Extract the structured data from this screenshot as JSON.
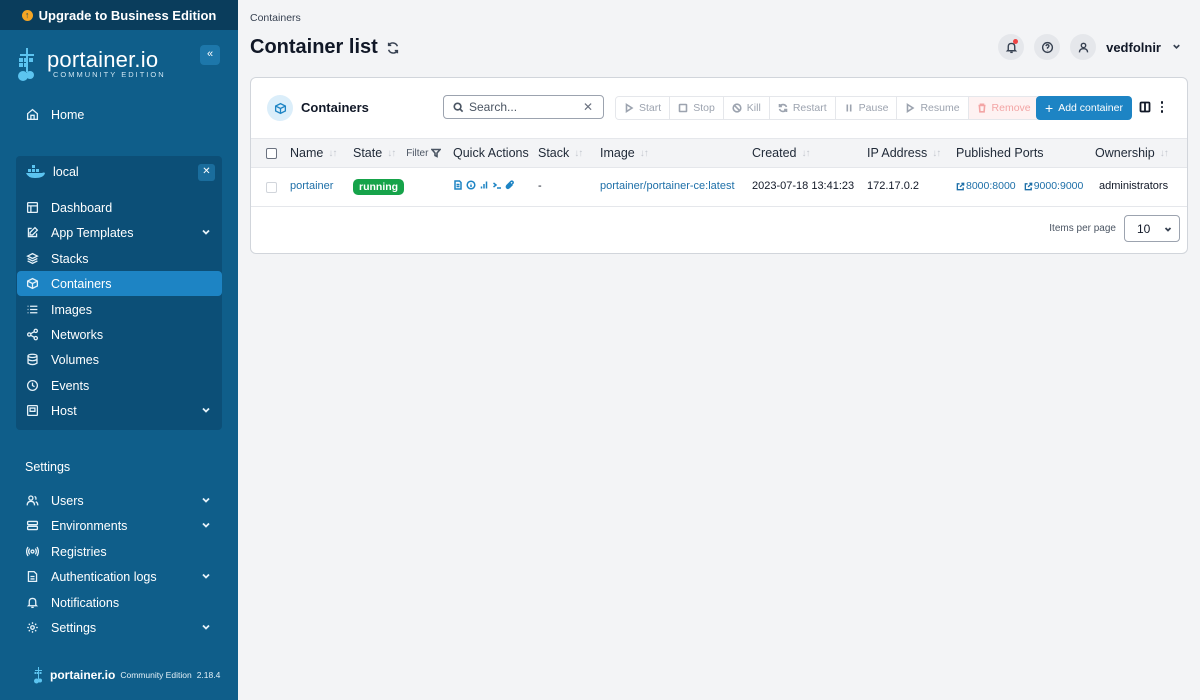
{
  "upgrade_banner": {
    "label": "Upgrade to Business Edition"
  },
  "brand": {
    "name": "portainer.io",
    "edition": "COMMUNITY EDITION"
  },
  "nav": {
    "home": "Home",
    "environment": {
      "name": "local"
    },
    "env_items": [
      {
        "label": "Dashboard",
        "icon": "dashboard-icon"
      },
      {
        "label": "App Templates",
        "icon": "edit-icon",
        "expandable": true
      },
      {
        "label": "Stacks",
        "icon": "layers-icon"
      },
      {
        "label": "Containers",
        "icon": "box-icon",
        "active": true
      },
      {
        "label": "Images",
        "icon": "list-icon"
      },
      {
        "label": "Networks",
        "icon": "share-icon"
      },
      {
        "label": "Volumes",
        "icon": "database-icon"
      },
      {
        "label": "Events",
        "icon": "clock-icon"
      },
      {
        "label": "Host",
        "icon": "host-icon",
        "expandable": true
      }
    ],
    "settings_title": "Settings",
    "settings_items": [
      {
        "label": "Users",
        "icon": "users-icon",
        "expandable": true
      },
      {
        "label": "Environments",
        "icon": "environments-icon",
        "expandable": true
      },
      {
        "label": "Registries",
        "icon": "registries-icon"
      },
      {
        "label": "Authentication logs",
        "icon": "file-icon",
        "expandable": true
      },
      {
        "label": "Notifications",
        "icon": "bell-icon"
      },
      {
        "label": "Settings",
        "icon": "gear-icon",
        "expandable": true
      }
    ]
  },
  "footer": {
    "brand": "portainer.io",
    "edition": "Community Edition",
    "version": "2.18.4"
  },
  "header": {
    "breadcrumb": "Containers",
    "title": "Container list",
    "username": "vedfolnir"
  },
  "panel": {
    "title": "Containers",
    "search_placeholder": "Search...",
    "actions": [
      "Start",
      "Stop",
      "Kill",
      "Restart",
      "Pause",
      "Resume",
      "Remove"
    ],
    "add_label": "Add container",
    "columns": {
      "name": "Name",
      "state": "State",
      "filter": "Filter",
      "quick_actions": "Quick Actions",
      "stack": "Stack",
      "image": "Image",
      "created": "Created",
      "ip": "IP Address",
      "ports": "Published Ports",
      "ownership": "Ownership"
    },
    "rows": [
      {
        "name": "portainer",
        "state": "running",
        "stack": "-",
        "image": "portainer/portainer-ce:latest",
        "created": "2023-07-18 13:41:23",
        "ip": "172.17.0.2",
        "ports": [
          "8000:8000",
          "9000:9000"
        ],
        "ownership": "administrators"
      }
    ],
    "items_per_page_label": "Items per page",
    "items_per_page": "10"
  },
  "colors": {
    "sidebar": "#0f5e8a",
    "accent": "#1d84c4",
    "running": "#16a34a"
  }
}
